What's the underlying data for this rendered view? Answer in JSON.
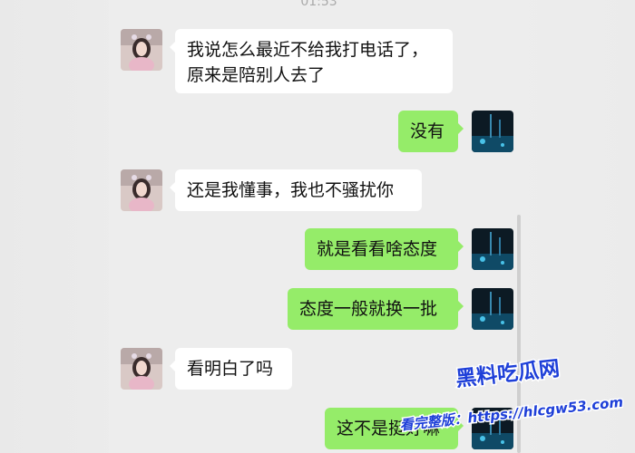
{
  "status": {
    "time": "01:53"
  },
  "messages": [
    {
      "side": "left",
      "text": "我说怎么最近不给我打电话了，\n原来是陪别人去了"
    },
    {
      "side": "right",
      "text": "没有"
    },
    {
      "side": "left",
      "text": "还是我懂事，我也不骚扰你"
    },
    {
      "side": "right",
      "text": "就是看看啥态度"
    },
    {
      "side": "right",
      "text": "态度一般就换一批"
    },
    {
      "side": "left",
      "text": "看明白了吗"
    },
    {
      "side": "right",
      "text": "这不是挺好嘛"
    }
  ],
  "watermark": {
    "line1": "黑料吃瓜网",
    "line2": "看完整版：https://hlcgw53.com"
  },
  "colors": {
    "chat_bg": "#ededed",
    "bubble_self": "#95ec69",
    "bubble_other": "#ffffff",
    "watermark_primary": "#1e3fd8"
  }
}
